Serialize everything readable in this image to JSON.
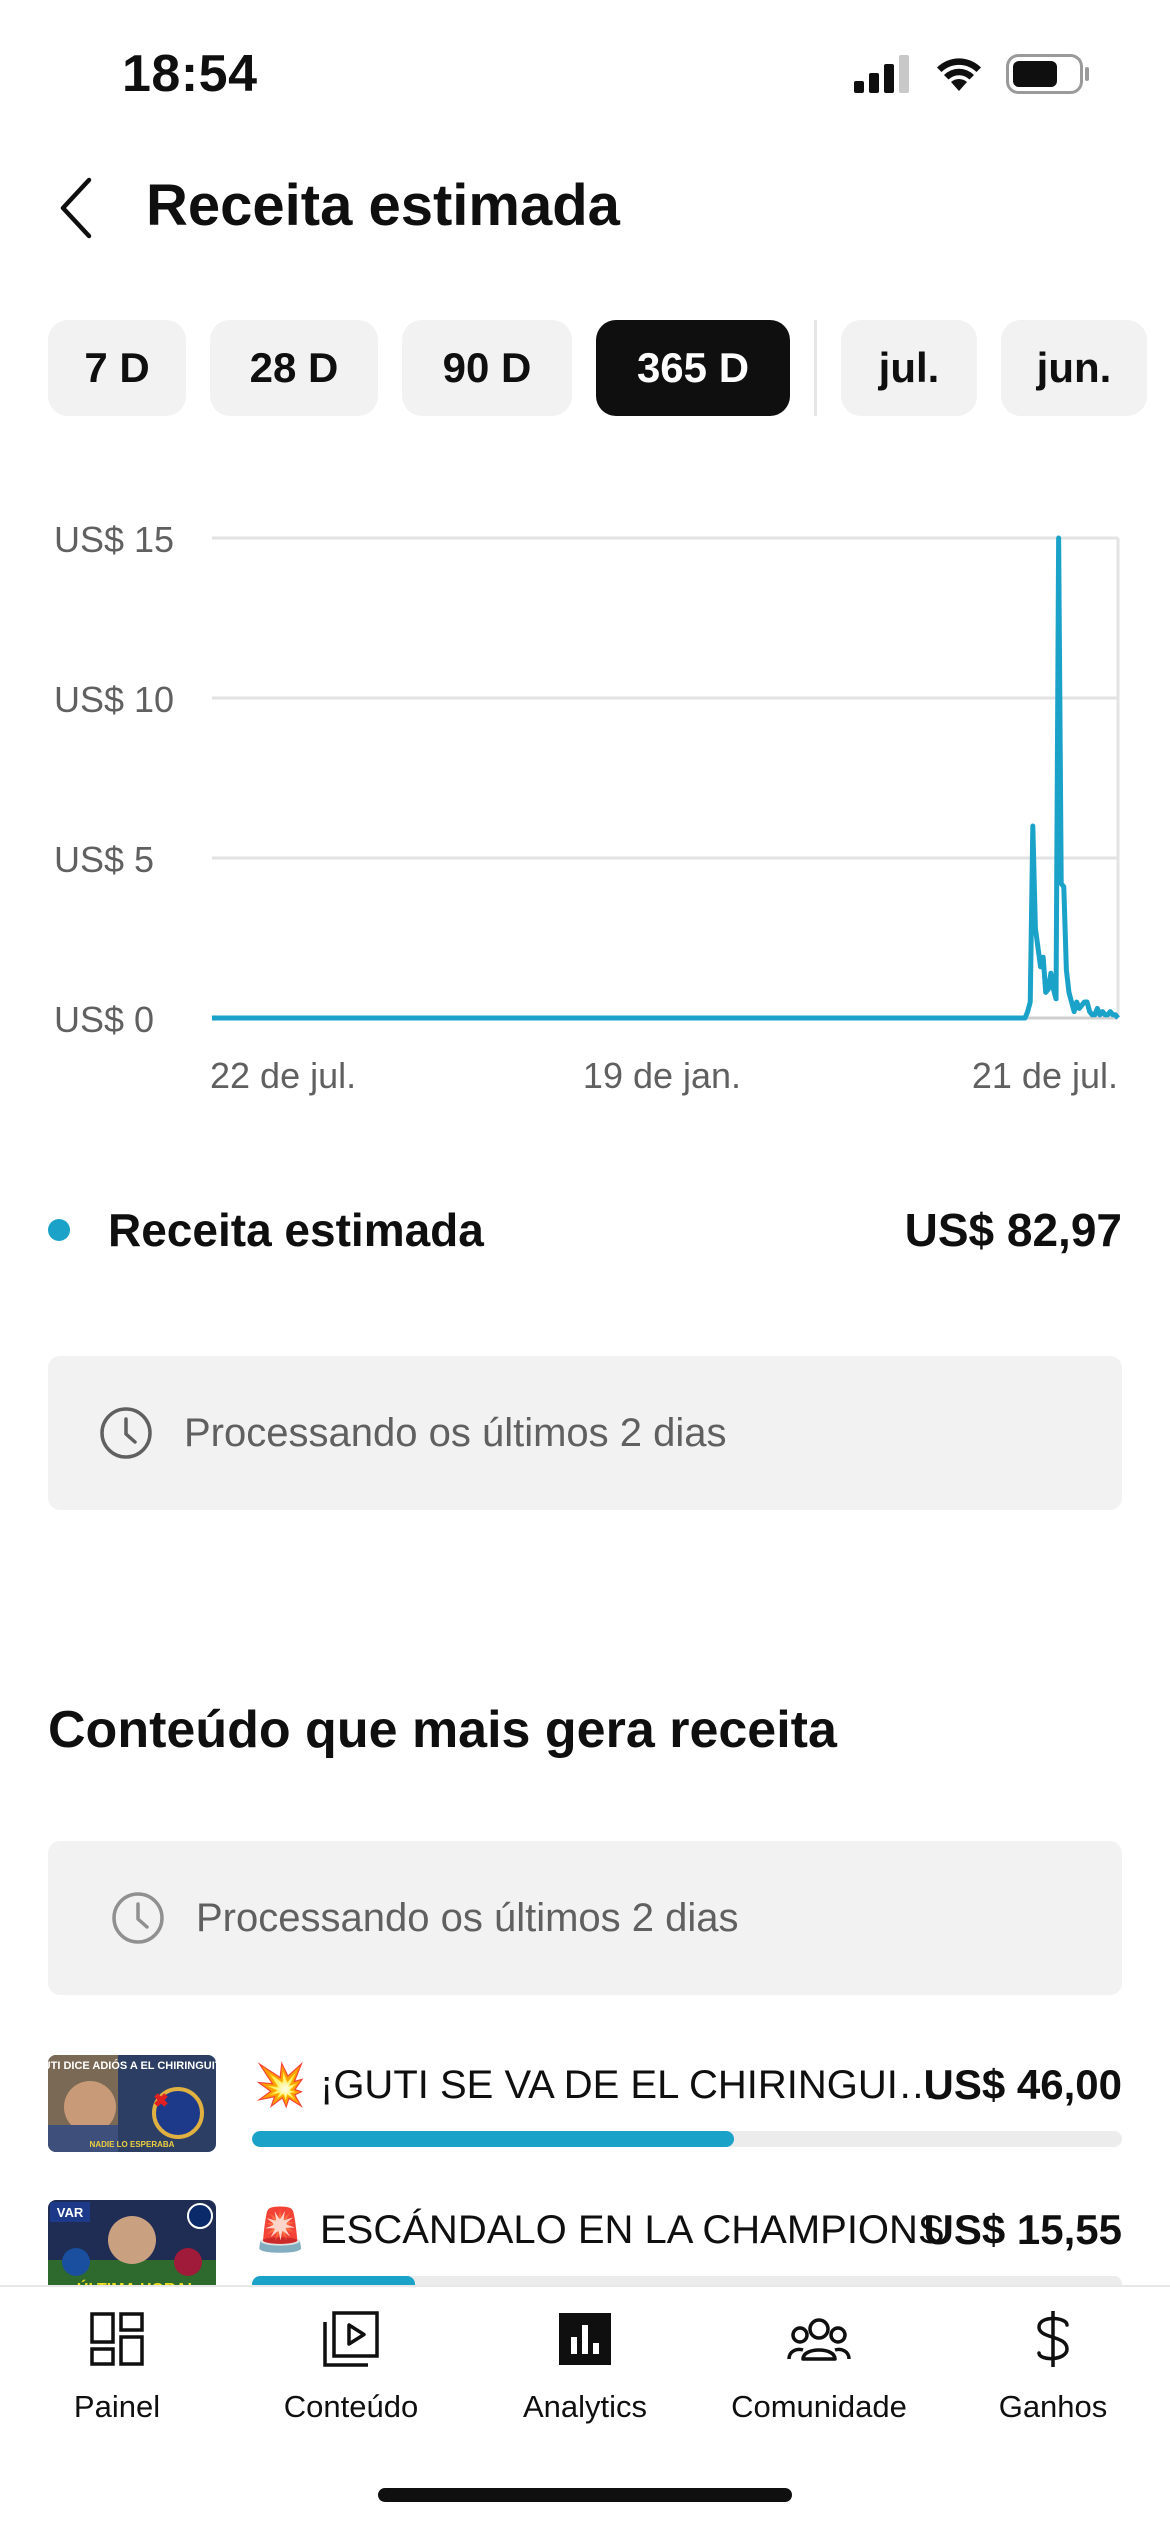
{
  "status_bar": {
    "time": "18:54"
  },
  "header": {
    "title": "Receita estimada"
  },
  "period_chips": [
    {
      "label": "7 D",
      "active": false
    },
    {
      "label": "28 D",
      "active": false
    },
    {
      "label": "90 D",
      "active": false
    },
    {
      "label": "365 D",
      "active": true
    },
    {
      "label": "jul.",
      "active": false
    },
    {
      "label": "jun.",
      "active": false
    }
  ],
  "chart_data": {
    "type": "line",
    "x_tick_labels": [
      "22 de jul.",
      "19 de jan.",
      "21 de jul."
    ],
    "y_tick_labels": [
      "US$ 15",
      "US$ 10",
      "US$ 5",
      "US$ 0"
    ],
    "ylim": [
      0,
      15
    ],
    "grid": true,
    "series_color": "#1aa2c9",
    "series": [
      {
        "values": [
          0,
          0,
          0,
          0,
          0,
          0,
          0,
          0,
          0,
          0,
          0,
          0,
          0,
          0,
          0,
          0,
          0,
          0,
          0,
          0,
          0,
          0,
          0,
          0,
          0,
          0,
          0,
          0,
          0,
          0,
          0,
          0,
          0,
          0,
          0,
          0,
          0,
          0,
          0,
          0,
          0,
          0,
          0,
          0,
          0,
          0,
          0,
          0,
          0,
          0,
          0,
          0,
          0,
          0,
          0,
          0,
          0,
          0,
          0,
          0,
          0,
          0,
          0,
          0,
          0,
          0,
          0,
          0,
          0,
          0,
          0,
          0,
          0,
          0,
          0,
          0,
          0,
          0,
          0,
          0,
          0,
          0,
          0,
          0,
          0,
          0,
          0,
          0,
          0,
          0,
          0,
          0,
          0,
          0,
          0,
          0,
          0,
          0,
          0,
          0,
          0,
          0,
          0,
          0,
          0,
          0,
          0,
          0,
          0,
          0,
          0,
          0,
          0,
          0,
          0,
          0,
          0,
          0,
          0,
          0,
          0,
          0,
          0,
          0,
          0,
          0,
          0,
          0,
          0,
          0,
          0,
          0,
          0,
          0,
          0,
          0,
          0,
          0,
          0,
          0,
          0,
          0,
          0,
          0,
          0,
          0,
          0,
          0,
          0,
          0,
          0,
          0,
          0,
          0,
          0,
          0,
          0,
          0,
          0,
          0,
          0,
          0,
          0,
          0,
          0,
          0,
          0,
          0,
          0,
          0,
          0,
          0,
          0,
          0,
          0,
          0,
          0,
          0,
          0,
          0,
          0,
          0,
          0,
          0,
          0,
          0,
          0,
          0,
          0,
          0,
          0,
          0,
          0,
          0,
          0,
          0,
          0,
          0,
          0,
          0,
          0,
          0,
          0,
          0,
          0,
          0,
          0,
          0,
          0,
          0,
          0,
          0,
          0,
          0,
          0,
          0,
          0,
          0,
          0,
          0,
          0,
          0,
          0,
          0,
          0,
          0,
          0,
          0,
          0,
          0,
          0,
          0,
          0,
          0,
          0,
          0,
          0,
          0,
          0,
          0,
          0,
          0,
          0,
          0,
          0,
          0,
          0,
          0,
          0,
          0,
          0,
          0,
          0,
          0,
          0,
          0,
          0,
          0,
          0,
          0,
          0,
          0,
          0,
          0,
          0,
          0,
          0,
          0,
          0,
          0,
          0,
          0,
          0,
          0,
          0,
          0,
          0,
          0,
          0,
          0,
          0,
          0,
          0,
          0,
          0,
          0,
          0,
          0,
          0,
          0,
          0,
          0,
          0,
          0,
          0,
          0,
          0,
          0,
          0,
          0,
          0,
          0,
          0,
          0,
          0,
          0,
          0,
          0,
          0,
          0,
          0,
          0,
          0,
          0,
          0,
          0,
          0.2,
          0.5,
          6,
          2.8,
          2.2,
          1.6,
          1.9,
          0.8,
          0.9,
          1.4,
          0.9,
          0.6,
          15,
          4.2,
          4.1,
          1.5,
          0.8,
          0.5,
          0.2,
          0.5,
          0.3,
          0.4,
          0.5,
          0.5,
          0.2,
          0.1,
          0.1,
          0.3,
          0.1,
          0.2,
          0.1,
          0.1,
          0.2,
          0.1,
          0.1,
          0
        ]
      }
    ]
  },
  "summary": {
    "label": "Receita estimada",
    "value": "US$ 82,97"
  },
  "notice_chart": {
    "text": "Processando os últimos 2 dias"
  },
  "top_content": {
    "title": "Conteúdo que mais gera receita",
    "notice": "Processando os últimos 2 dias",
    "items": [
      {
        "emoji": "💥",
        "title": "¡GUTI SE VA DE EL CHIRINGUITO!",
        "value": "US$ 46,00",
        "share": 0.5545,
        "thumb_text": "¡GUTI DICE ADIÓS A EL CHIRINGUITO!",
        "thumb_sub": "NADIE LO ESPERABA"
      },
      {
        "emoji": "🚨",
        "title": "ESCÁNDALO EN LA CHAMPIONS",
        "value": "US$ 15,55",
        "share": 0.1874,
        "thumb_text": "¡ÚLTIMA HORA!",
        "thumb_sub": "VAR"
      }
    ]
  },
  "bottom_nav": [
    {
      "label": "Painel",
      "icon": "dashboard-icon"
    },
    {
      "label": "Conteúdo",
      "icon": "content-icon"
    },
    {
      "label": "Analytics",
      "icon": "analytics-icon",
      "active": true
    },
    {
      "label": "Comunidade",
      "icon": "community-icon"
    },
    {
      "label": "Ganhos",
      "icon": "dollar-icon"
    }
  ]
}
